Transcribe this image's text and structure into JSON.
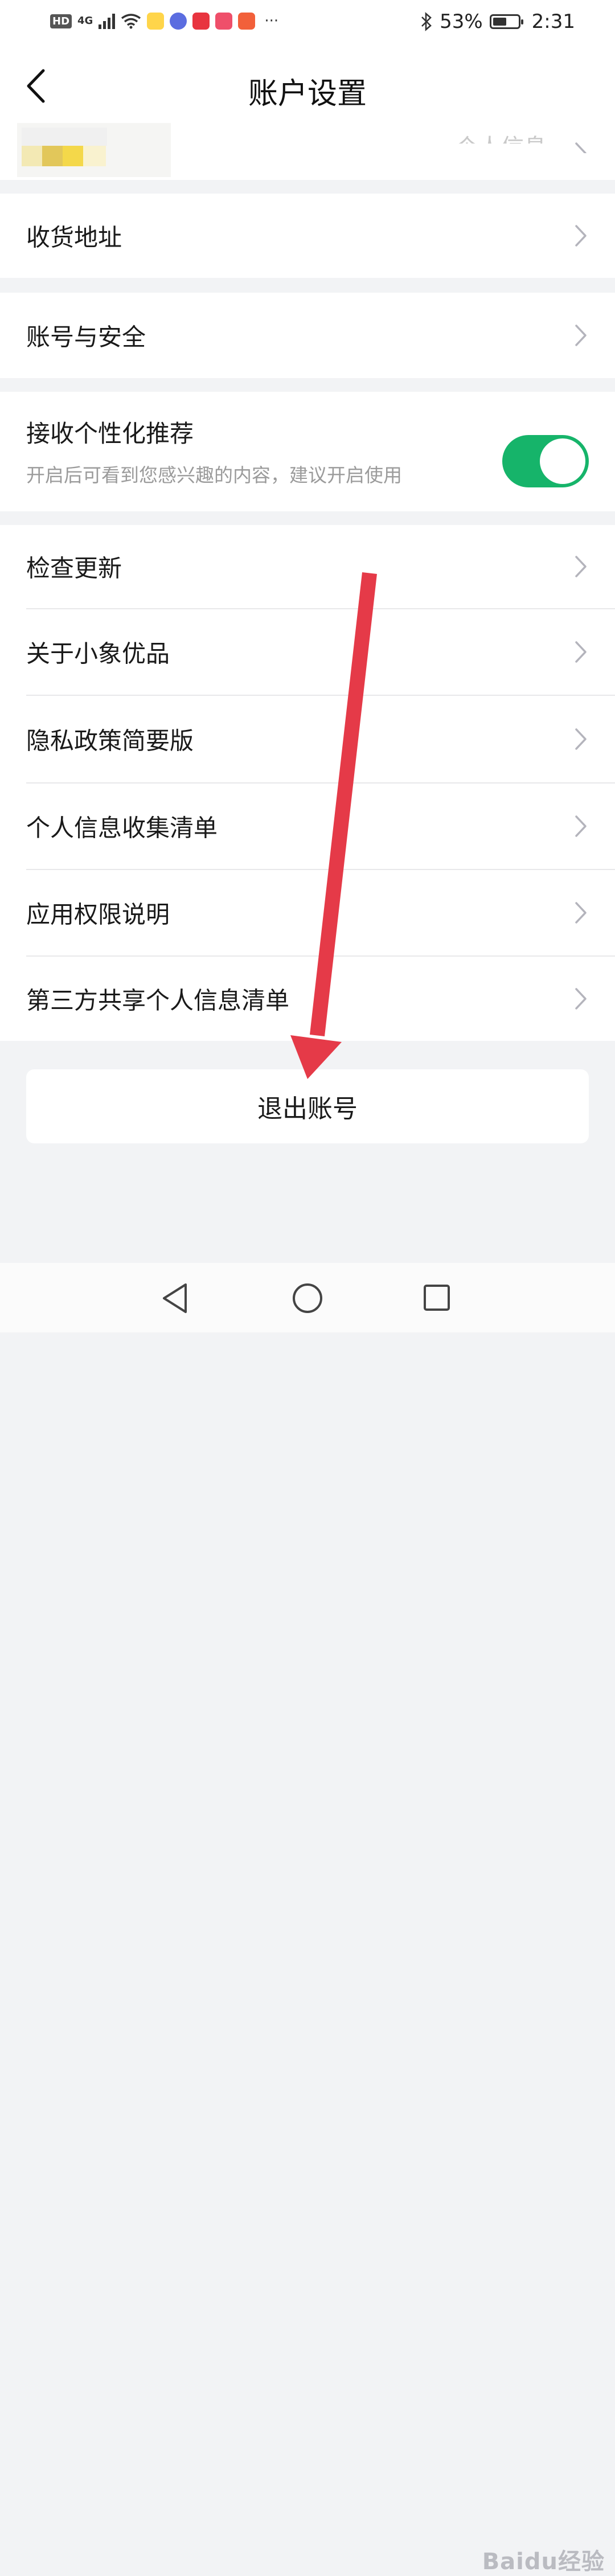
{
  "status_bar": {
    "hd": "HD",
    "network": "4G",
    "battery_percent": "53%",
    "battery_level": 0.53,
    "time": "2:31",
    "more": "···"
  },
  "header": {
    "title": "账户设置"
  },
  "profile": {
    "label": "个人信息"
  },
  "rows": {
    "address": "收货地址",
    "account_security": "账号与安全",
    "check_update": "检查更新",
    "about": "关于小象优品",
    "privacy_summary": "隐私政策简要版",
    "personal_info_list": "个人信息收集清单",
    "app_permissions": "应用权限说明",
    "third_party_list": "第三方共享个人信息清单"
  },
  "recommend": {
    "title": "接收个性化推荐",
    "subtitle": "开启后可看到您感兴趣的内容，建议开启使用",
    "enabled": true
  },
  "logout": {
    "label": "退出账号"
  },
  "watermark": {
    "text": "Baidu经验"
  },
  "colors": {
    "toggle_on": "#16b46a",
    "annotation_arrow": "#e53a48",
    "page_bg": "#f2f3f5"
  }
}
